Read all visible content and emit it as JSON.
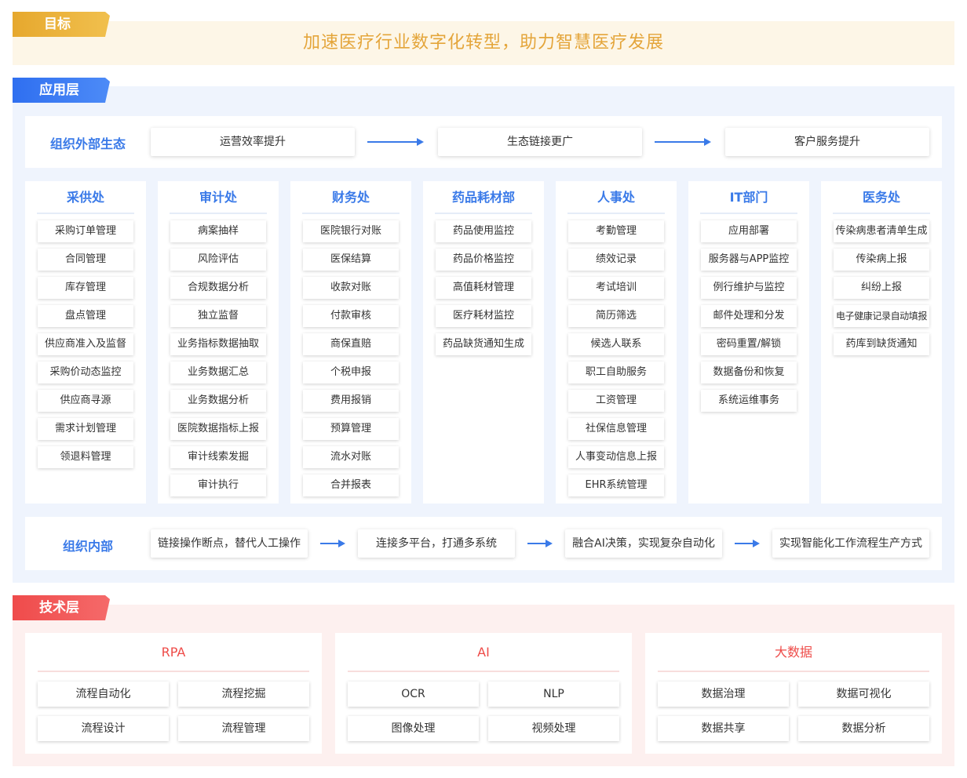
{
  "goal": {
    "tag": "目标",
    "text": "加速医疗行业数字化转型，助力智慧医疗发展"
  },
  "app_layer": {
    "tag": "应用层",
    "external": {
      "title": "组织外部生态",
      "steps": [
        "运营效率提升",
        "生态链接更广",
        "客户服务提升"
      ]
    },
    "departments": [
      {
        "name": "采供处",
        "items": [
          "采购订单管理",
          "合同管理",
          "库存管理",
          "盘点管理",
          "供应商准入及监督",
          "采购价动态监控",
          "供应商寻源",
          "需求计划管理",
          "领退料管理"
        ]
      },
      {
        "name": "审计处",
        "items": [
          "病案抽样",
          "风险评估",
          "合规数据分析",
          "独立监督",
          "业务指标数据抽取",
          "业务数据汇总",
          "业务数据分析",
          "医院数据指标上报",
          "审计线索发掘",
          "审计执行"
        ]
      },
      {
        "name": "财务处",
        "items": [
          "医院银行对账",
          "医保结算",
          "收款对账",
          "付款审核",
          "商保直赔",
          "个税申报",
          "费用报销",
          "预算管理",
          "流水对账",
          "合并报表"
        ]
      },
      {
        "name": "药品耗材部",
        "items": [
          "药品使用监控",
          "药品价格监控",
          "高值耗材管理",
          "医疗耗材监控",
          "药品缺货通知生成"
        ]
      },
      {
        "name": "人事处",
        "items": [
          "考勤管理",
          "绩效记录",
          "考试培训",
          "简历筛选",
          "候选人联系",
          "职工自助服务",
          "工资管理",
          "社保信息管理",
          "人事变动信息上报",
          "EHR系统管理"
        ]
      },
      {
        "name": "IT部门",
        "items": [
          "应用部署",
          "服务器与APP监控",
          "例行维护与监控",
          "邮件处理和分发",
          "密码重置/解锁",
          "数据备份和恢复",
          "系统运维事务"
        ]
      },
      {
        "name": "医务处",
        "items": [
          "传染病患者清单生成",
          "传染病上报",
          "纠纷上报",
          "电子健康记录自动填报",
          "药库到缺货通知"
        ]
      }
    ],
    "internal": {
      "title": "组织内部",
      "steps": [
        "链接操作断点，替代人工操作",
        "连接多平台，打通多系统",
        "融合AI决策，实现复杂自动化",
        "实现智能化工作流程生产方式"
      ]
    }
  },
  "tech_layer": {
    "tag": "技术层",
    "groups": [
      {
        "name": "RPA",
        "items": [
          "流程自动化",
          "流程挖掘",
          "流程设计",
          "流程管理"
        ]
      },
      {
        "name": "AI",
        "items": [
          "OCR",
          "NLP",
          "图像处理",
          "视频处理"
        ]
      },
      {
        "name": "大数据",
        "items": [
          "数据治理",
          "数据可视化",
          "数据共享",
          "数据分析"
        ]
      }
    ]
  },
  "colors": {
    "goal_accent": "#e4a53a",
    "app_accent": "#3a7ae8",
    "tech_accent": "#ee4b48"
  }
}
